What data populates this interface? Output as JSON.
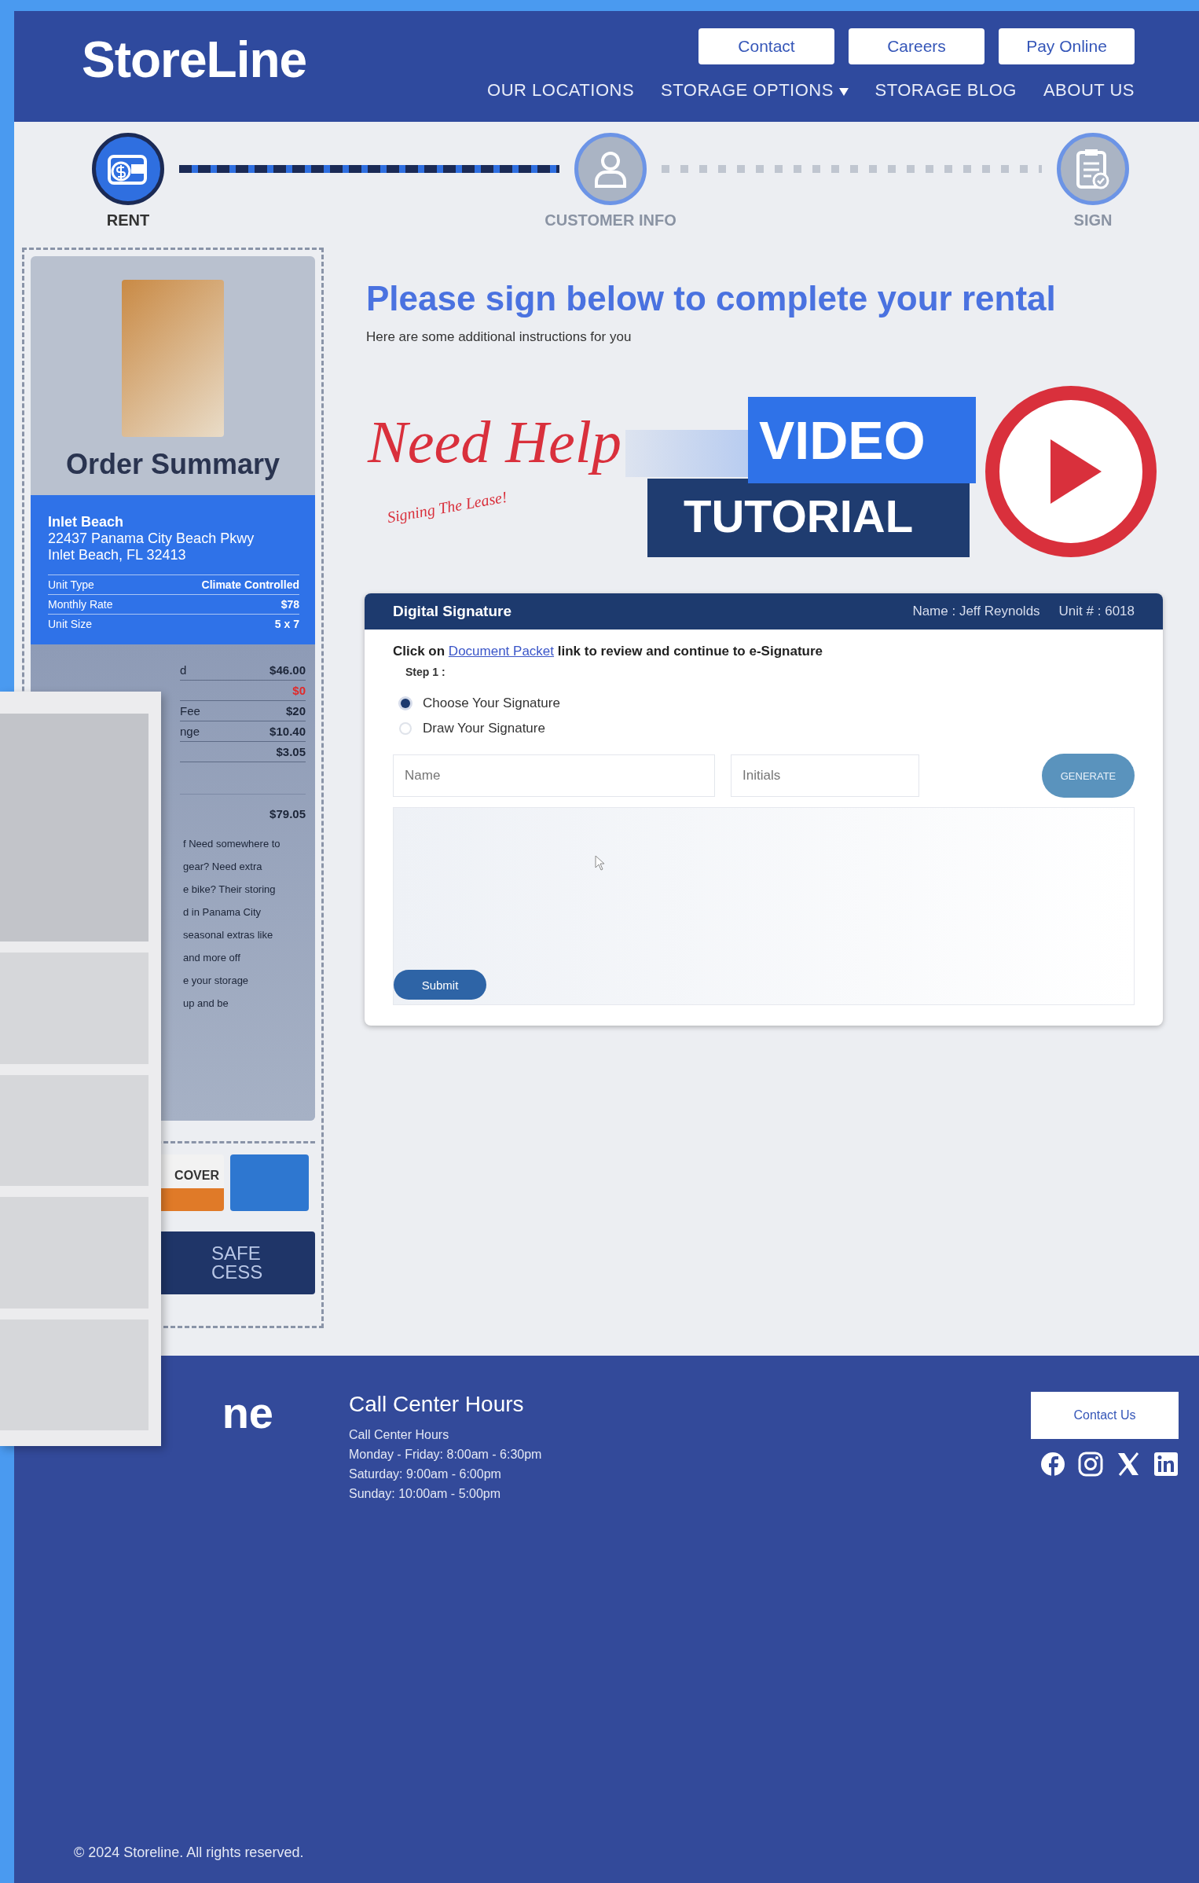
{
  "header": {
    "logo": "StoreLine",
    "buttons": [
      "Contact",
      "Careers",
      "Pay Online"
    ],
    "nav": [
      {
        "label": "OUR LOCATIONS",
        "dropdown": false
      },
      {
        "label": "STORAGE OPTIONS",
        "dropdown": true
      },
      {
        "label": "STORAGE BLOG",
        "dropdown": false
      },
      {
        "label": "ABOUT US",
        "dropdown": false
      }
    ]
  },
  "steps": [
    {
      "label": "RENT",
      "kind": "wallet",
      "selected": true
    },
    {
      "label": "CUSTOMER INFO",
      "kind": "person",
      "selected": false
    },
    {
      "label": "SIGN",
      "kind": "clipboard",
      "selected": false
    }
  ],
  "order_summary": {
    "title": "Order Summary",
    "location": {
      "name": "Inlet Beach",
      "address": "22437 Panama City Beach Pkwy",
      "city": "Inlet Beach, FL 32413"
    },
    "unit_rows": [
      {
        "label": "Unit Type",
        "value": "Climate Controlled"
      },
      {
        "label": "Monthly Rate",
        "value": "$78"
      },
      {
        "label": "Unit Size",
        "value": "5 x 7"
      }
    ],
    "price_rows": [
      {
        "label": "d",
        "value": "$46.00",
        "kind": "charge"
      },
      {
        "value": "$0",
        "kind": "discount"
      },
      {
        "label": "Fee",
        "value": "$20",
        "kind": "charge"
      },
      {
        "label": "nge",
        "value": "$10.40",
        "kind": "charge"
      },
      {
        "value": "$3.05",
        "kind": "charge"
      }
    ],
    "total": "$79.05",
    "promo_lines": [
      "f Need somewhere to",
      "gear? Need extra",
      "e bike? Their storing",
      "d in Panama City",
      "seasonal extras like",
      "and more off",
      "e your storage",
      "up and be"
    ],
    "card_logo_text": "COVER",
    "badge_lines": [
      "SAFE",
      "CESS"
    ]
  },
  "main": {
    "title": "Please sign below to complete your rental",
    "subtitle": "Here are some additional instructions for you",
    "banner": {
      "need_help": "Need Help",
      "tagline": "Signing The Lease!",
      "video": "VIDEO",
      "tutorial": "TUTORIAL"
    },
    "signature": {
      "title": "Digital Signature",
      "name_info": "Name : Jeff Reynolds",
      "unit_info": "Unit # : 6018",
      "instruction_before": "Click on",
      "link": "Document Packet",
      "instruction_after": "link to review and continue to e-Signature",
      "step": "Step 1 :",
      "options": [
        {
          "label": "Choose Your Signature",
          "selected": true
        },
        {
          "label": "Draw Your Signature",
          "selected": false
        }
      ],
      "name_placeholder": "Name",
      "initials_placeholder": "Initials",
      "generate": "GENERATE",
      "submit": "Submit"
    }
  },
  "footer": {
    "logo_fragment": "ne",
    "heading": "Call Center Hours",
    "lines": [
      "Call Center Hours",
      "Monday - Friday: 8:00am - 6:30pm",
      "Saturday: 9:00am - 6:00pm",
      "Sunday: 10:00am - 5:00pm"
    ],
    "contact": "Contact Us",
    "social": [
      {
        "kind": "facebook"
      },
      {
        "kind": "instagram"
      },
      {
        "kind": "x"
      },
      {
        "kind": "linkedin"
      }
    ],
    "copyright": "© 2024 Storeline. All rights reserved."
  }
}
